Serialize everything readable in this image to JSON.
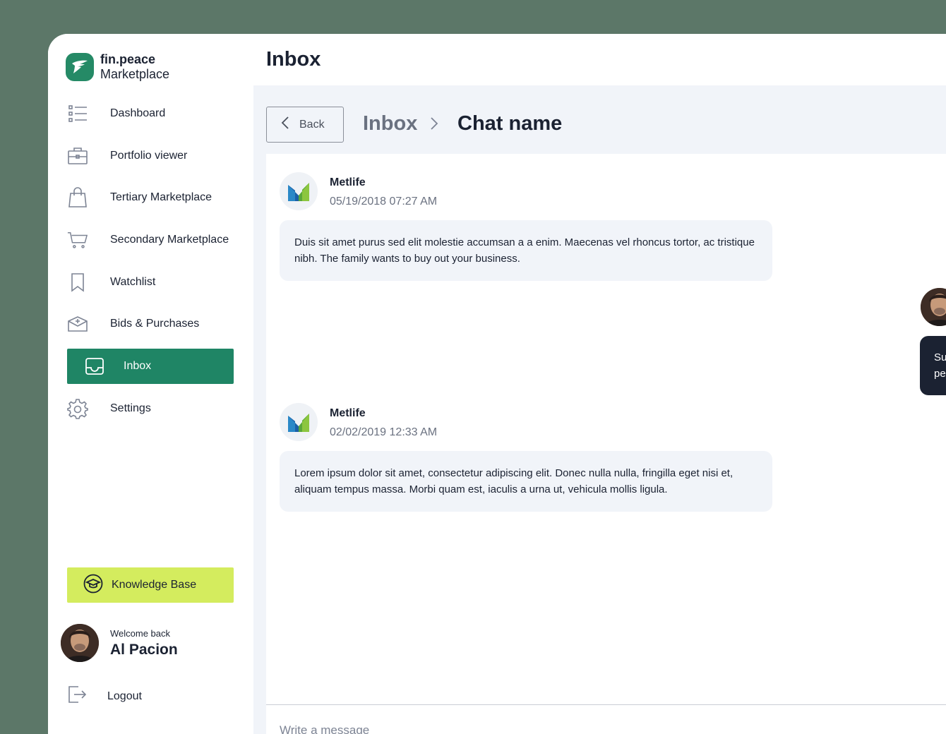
{
  "brand": {
    "name": "fin.peace",
    "subtitle": "Marketplace",
    "color": "#258a66"
  },
  "page": {
    "title": "Inbox"
  },
  "sidebar": {
    "items": [
      {
        "label": "Dashboard",
        "icon": "list-icon"
      },
      {
        "label": "Portfolio viewer",
        "icon": "briefcase-icon"
      },
      {
        "label": "Tertiary Marketplace",
        "icon": "shopping-bag-icon"
      },
      {
        "label": "Secondary Marketplace",
        "icon": "cart-icon"
      },
      {
        "label": "Watchlist",
        "icon": "bookmark-icon"
      },
      {
        "label": "Bids & Purchases",
        "icon": "box-icon"
      },
      {
        "label": "Inbox",
        "icon": "inbox-icon",
        "active": true
      },
      {
        "label": "Settings",
        "icon": "gear-icon"
      }
    ],
    "knowledge_base": {
      "label": "Knowledge Base",
      "icon": "graduation-cap-icon",
      "color": "#d4ec5e"
    },
    "user": {
      "welcome": "Welcome back",
      "name": "Al Pacion"
    },
    "logout": {
      "label": "Logout",
      "icon": "logout-icon"
    }
  },
  "breadcrumb": {
    "back_label": "Back",
    "parent": "Inbox",
    "current": "Chat name"
  },
  "messages": [
    {
      "sender": "Metlife",
      "time": "05/19/2018 07:27 AM",
      "text": "Duis sit amet purus sed elit molestie accumsan a a enim. Maecenas vel rhoncus tortor, ac tristique nibh.  The family wants to buy out your business."
    },
    {
      "sender": "Metlife",
      "time": "02/02/2019 12:33 AM",
      "text": "Lorem ipsum dolor sit amet, consectetur adipiscing elit. Donec nulla nulla, fringilla eget nisi et, aliquam tempus massa. Morbi quam est, iaculis a urna ut, vehicula mollis ligula."
    }
  ],
  "outgoing": {
    "line1": "Su",
    "line2": "pe"
  },
  "composer": {
    "placeholder": "Write a message"
  },
  "colors": {
    "accent": "#1f8565",
    "background": "#5c7768",
    "panel": "#f1f4f9",
    "dark_bubble": "#1b2232"
  }
}
